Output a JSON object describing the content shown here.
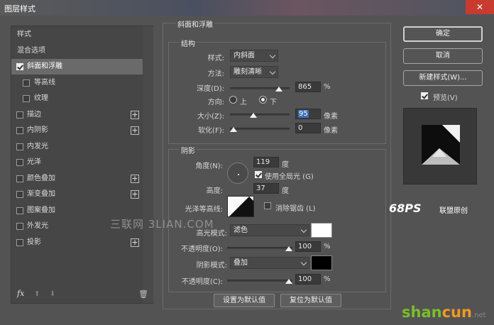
{
  "window": {
    "title": "图层样式",
    "close_glyph": "✕"
  },
  "sidebar": {
    "items": [
      {
        "label": "样式",
        "checkbox": false,
        "checked": false,
        "plus": false,
        "selected": false,
        "sub": false
      },
      {
        "label": "混合选项",
        "checkbox": false,
        "checked": false,
        "plus": false,
        "selected": false,
        "sub": false
      },
      {
        "label": "斜面和浮雕",
        "checkbox": true,
        "checked": true,
        "plus": false,
        "selected": true,
        "sub": false
      },
      {
        "label": "等高线",
        "checkbox": true,
        "checked": false,
        "plus": false,
        "selected": false,
        "sub": true
      },
      {
        "label": "纹理",
        "checkbox": true,
        "checked": false,
        "plus": false,
        "selected": false,
        "sub": true
      },
      {
        "label": "描边",
        "checkbox": true,
        "checked": false,
        "plus": true,
        "selected": false,
        "sub": false
      },
      {
        "label": "内阴影",
        "checkbox": true,
        "checked": false,
        "plus": true,
        "selected": false,
        "sub": false
      },
      {
        "label": "内发光",
        "checkbox": true,
        "checked": false,
        "plus": false,
        "selected": false,
        "sub": false
      },
      {
        "label": "光泽",
        "checkbox": true,
        "checked": false,
        "plus": false,
        "selected": false,
        "sub": false
      },
      {
        "label": "颜色叠加",
        "checkbox": true,
        "checked": false,
        "plus": true,
        "selected": false,
        "sub": false
      },
      {
        "label": "渐变叠加",
        "checkbox": true,
        "checked": false,
        "plus": true,
        "selected": false,
        "sub": false
      },
      {
        "label": "图案叠加",
        "checkbox": true,
        "checked": false,
        "plus": false,
        "selected": false,
        "sub": false
      },
      {
        "label": "外发光",
        "checkbox": true,
        "checked": false,
        "plus": false,
        "selected": false,
        "sub": false
      },
      {
        "label": "投影",
        "checkbox": true,
        "checked": false,
        "plus": true,
        "selected": false,
        "sub": false
      }
    ],
    "footer": {
      "fx": "fx",
      "up": "⬆",
      "down": "⬇",
      "trash": "🗑"
    }
  },
  "bevel": {
    "section_title": "斜面和浮雕",
    "structure_title": "结构",
    "style_label": "样式:",
    "style_value": "内斜面",
    "technique_label": "方法:",
    "technique_value": "雕刻清晰",
    "depth_label": "深度(D):",
    "depth_value": "865",
    "depth_unit": "%",
    "depth_level": 0.86,
    "direction_label": "方向:",
    "direction_up": "上",
    "direction_down": "下",
    "direction_selected": "下",
    "size_label": "大小(Z):",
    "size_value": "95",
    "size_unit": "像素",
    "size_level": 0.38,
    "soften_label": "软化(F):",
    "soften_value": "0",
    "soften_unit": "像素",
    "soften_level": 0,
    "shading_title": "阴影",
    "angle_label": "角度(N):",
    "angle_value": "119",
    "angle_unit": "度",
    "global_light_label": "使用全局光 (G)",
    "global_light_checked": true,
    "altitude_label": "高度:",
    "altitude_value": "37",
    "altitude_unit": "度",
    "gloss_contour_label": "光泽等高线:",
    "antialias_label": "消除锯齿 (L)",
    "antialias_checked": false,
    "highlight_mode_label": "高光模式:",
    "highlight_mode_value": "滤色",
    "highlight_color": "#ffffff",
    "highlight_opacity_label": "不透明度(O):",
    "highlight_opacity_value": "100",
    "highlight_opacity_unit": "%",
    "highlight_opacity_level": 1.0,
    "shadow_mode_label": "阴影模式:",
    "shadow_mode_value": "叠加",
    "shadow_color": "#000000",
    "shadow_opacity_label": "不透明度(C):",
    "shadow_opacity_value": "100",
    "shadow_opacity_unit": "%",
    "shadow_opacity_level": 1.0,
    "make_default": "设置为默认值",
    "reset_default": "复位为默认值"
  },
  "actions": {
    "ok": "确定",
    "cancel": "取消",
    "new_style": "新建样式(W)...",
    "preview_label": "预览(V)",
    "preview_checked": true
  },
  "watermarks": {
    "sanlian": "三联网 3LIAN.COM",
    "ps_logo": "68PS",
    "ps_text": "联盟原创",
    "shancun_a": "shan",
    "shancun_b": "cun",
    "shancun_c": ".net"
  }
}
